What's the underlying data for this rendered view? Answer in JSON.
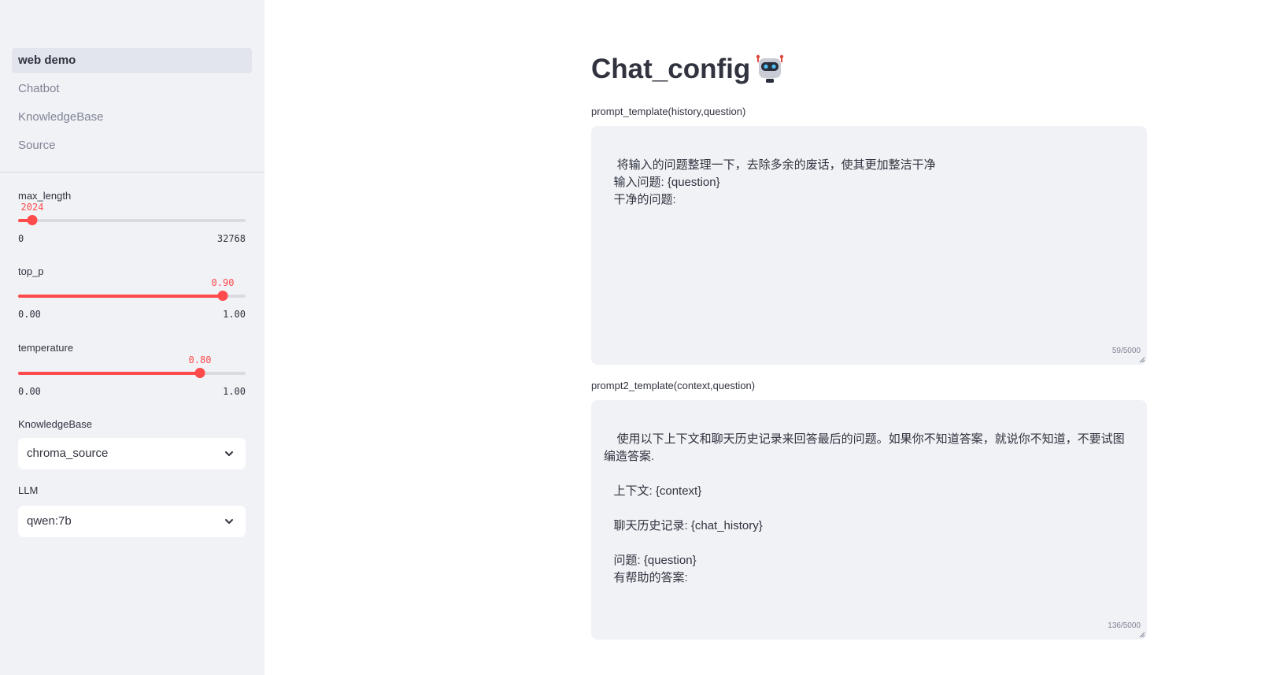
{
  "sidebar": {
    "nav": [
      {
        "label": "web demo",
        "active": true
      },
      {
        "label": "Chatbot",
        "active": false
      },
      {
        "label": "KnowledgeBase",
        "active": false
      },
      {
        "label": "Source",
        "active": false
      }
    ],
    "max_length": {
      "label": "max_length",
      "value": "2024",
      "min": "0",
      "max": "32768",
      "fraction": 0.0618
    },
    "top_p": {
      "label": "top_p",
      "value": "0.90",
      "min": "0.00",
      "max": "1.00",
      "fraction": 0.9
    },
    "temperature": {
      "label": "temperature",
      "value": "0.80",
      "min": "0.00",
      "max": "1.00",
      "fraction": 0.8
    },
    "knowledge_base": {
      "label": "KnowledgeBase",
      "selected": "chroma_source"
    },
    "llm": {
      "label": "LLM",
      "selected": "qwen:7b"
    }
  },
  "main": {
    "title": "Chat_config",
    "title_icon": "robot-emoji-icon",
    "prompt_template": {
      "label": "prompt_template(history,question)",
      "value": "将输入的问题整理一下，去除多余的废话，使其更加整洁干净\n   输入问题: {question}\n   干净的问题:",
      "counter": "59/5000"
    },
    "prompt2_template": {
      "label": "prompt2_template(context,question)",
      "value": "使用以下上下文和聊天历史记录来回答最后的问题。如果你不知道答案，就说你不知道，不要试图编造答案.\n\n   上下文: {context}\n\n   聊天历史记录: {chat_history}\n\n   问题: {question}\n   有帮助的答案:",
      "counter": "136/5000"
    }
  },
  "colors": {
    "accent": "#ff4b4b",
    "sidebar_bg": "#f0f2f6",
    "text": "#31333f",
    "muted": "#808495"
  }
}
